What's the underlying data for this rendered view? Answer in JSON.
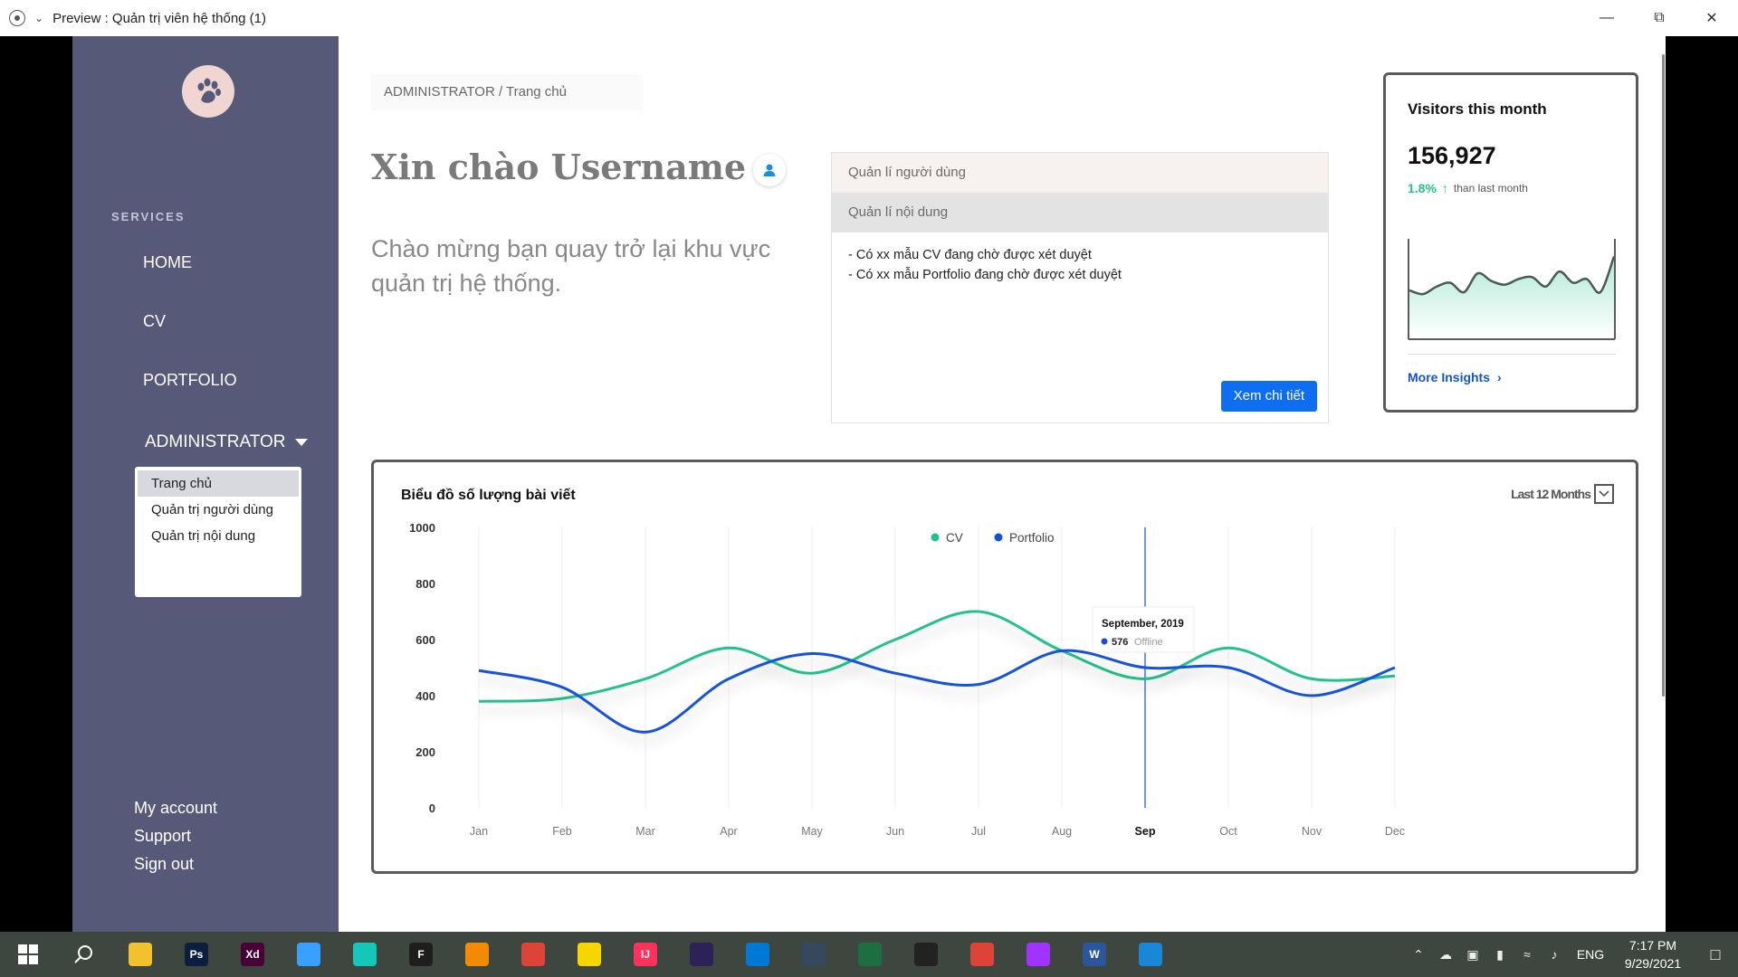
{
  "window": {
    "title": "Preview : Quản trị viên hệ thống (1)"
  },
  "sidebar": {
    "services_label": "SERVICES",
    "items": [
      "HOME",
      "CV",
      "PORTFOLIO"
    ],
    "admin_label": "ADMINISTRATOR",
    "dropdown": [
      "Trang chủ",
      "Quản trị người dùng",
      "Quản trị nội dung"
    ],
    "bottom": [
      "My account",
      "Support",
      "Sign out"
    ]
  },
  "breadcrumb": "ADMINISTRATOR / Trang chủ",
  "greeting": "Xin chào Username",
  "welcome": "Chào mừng bạn quay trở lại khu vực quản trị hệ thống.",
  "panel": {
    "tab1": "Quản lí người dùng",
    "tab2": "Quản lí nội dung",
    "lines": [
      "- Có xx mẫu CV đang chờ được xét duyệt",
      "- Có xx mẫu Portfolio đang chờ được xét duyệt"
    ],
    "button": "Xem chi tiết"
  },
  "visitors": {
    "title": "Visitors this month",
    "value": "156,927",
    "change": "1.8%",
    "change_text": "than last month",
    "link": "More Insights",
    "sparkline": [
      52,
      48,
      56,
      60,
      50,
      70,
      62,
      58,
      64,
      66,
      56,
      72,
      60,
      64,
      50,
      88
    ],
    "color": "#21c28a"
  },
  "chart_data": {
    "type": "line",
    "title": "Biểu đồ số lượng bài viết",
    "range_label": "Last 12 Months",
    "categories": [
      "Jan",
      "Feb",
      "Mar",
      "Apr",
      "May",
      "Jun",
      "Jul",
      "Aug",
      "Sep",
      "Oct",
      "Nov",
      "Dec"
    ],
    "ylim": [
      0,
      1000
    ],
    "yticks": [
      0,
      200,
      400,
      600,
      800,
      1000
    ],
    "highlight_category": "Sep",
    "series": [
      {
        "name": "CV",
        "color": "#21c28a",
        "values": [
          380,
          390,
          460,
          570,
          480,
          600,
          700,
          560,
          460,
          570,
          460,
          470
        ]
      },
      {
        "name": "Portfolio",
        "color": "#1251e0",
        "values": [
          490,
          430,
          270,
          460,
          550,
          480,
          440,
          560,
          500,
          500,
          400,
          500
        ]
      }
    ],
    "tooltip": {
      "title": "September, 2019",
      "value": "576",
      "label": "Offline"
    }
  },
  "taskbar": {
    "lang": "ENG",
    "time": "7:17 PM",
    "date": "9/29/2021",
    "apps": [
      {
        "name": "file-explorer-icon",
        "color": "#f2c12e",
        "text": ""
      },
      {
        "name": "photoshop-icon",
        "color": "#0b1e3f",
        "text": "Ps"
      },
      {
        "name": "adobe-xd-icon",
        "color": "#470137",
        "text": "Xd"
      },
      {
        "name": "app-square-icon",
        "color": "#3aa0ff",
        "text": ""
      },
      {
        "name": "app-circle-icon",
        "color": "#14c7b8",
        "text": ""
      },
      {
        "name": "figma-icon",
        "color": "#1e1e1e",
        "text": "F"
      },
      {
        "name": "app-orange-icon",
        "color": "#f28b00",
        "text": ""
      },
      {
        "name": "chrome-icon",
        "color": "#db4437",
        "text": ""
      },
      {
        "name": "sticky-notes-icon",
        "color": "#f7d600",
        "text": ""
      },
      {
        "name": "intellij-icon",
        "color": "#fe315d",
        "text": "IJ"
      },
      {
        "name": "eclipse-icon",
        "color": "#2c2255",
        "text": ""
      },
      {
        "name": "vscode-icon",
        "color": "#0078d4",
        "text": ""
      },
      {
        "name": "app-cube-icon",
        "color": "#34495e",
        "text": ""
      },
      {
        "name": "excel-icon",
        "color": "#1d6f42",
        "text": ""
      },
      {
        "name": "obs-icon",
        "color": "#222222",
        "text": ""
      },
      {
        "name": "chrome-2-icon",
        "color": "#db4437",
        "text": ""
      },
      {
        "name": "messenger-icon",
        "color": "#a033ff",
        "text": ""
      },
      {
        "name": "word-icon",
        "color": "#2b579a",
        "text": "W"
      },
      {
        "name": "media-player-icon",
        "color": "#1a86d6",
        "text": ""
      }
    ]
  }
}
